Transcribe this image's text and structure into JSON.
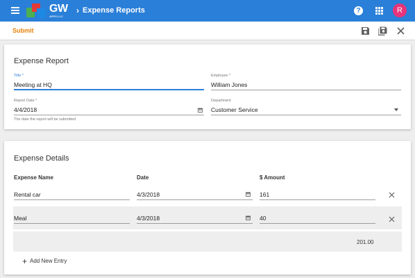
{
  "header": {
    "logo_text": "GW",
    "logo_subtext": "APPS LLC",
    "breadcrumb_chevron": "›",
    "breadcrumb_title": "Expense Reports",
    "help_glyph": "?",
    "avatar_initial": "R",
    "colors": {
      "appbar": "#2a7fd8",
      "avatar": "#e8347a",
      "logo": [
        "#4caf50",
        "#e53935",
        "#1e88e5"
      ]
    }
  },
  "toolbar": {
    "submit_label": "Submit",
    "icons": [
      "save-icon",
      "save-copy-icon",
      "close-icon"
    ],
    "accent": "#e5830a"
  },
  "report": {
    "title": "Expense Report",
    "fields": {
      "title": {
        "label": "Title *",
        "value": "Meeting at HQ"
      },
      "employee": {
        "label": "Employee *",
        "value": "William Jones"
      },
      "report_date": {
        "label": "Report Date *",
        "value": "4/4/2018",
        "helper": "The date the report will be submitted"
      },
      "department": {
        "label": "Department",
        "value": "Customer Service"
      }
    }
  },
  "details": {
    "title": "Expense Details",
    "columns": [
      "Expense Name",
      "Date",
      "$ Amount"
    ],
    "rows": [
      {
        "name": "Rental car",
        "date": "4/3/2018",
        "amount": "161"
      },
      {
        "name": "Meal",
        "date": "4/3/2018",
        "amount": "40"
      }
    ],
    "total": "201.00",
    "add_entry_glyph": "+",
    "add_entry_label": "Add New Entry"
  }
}
